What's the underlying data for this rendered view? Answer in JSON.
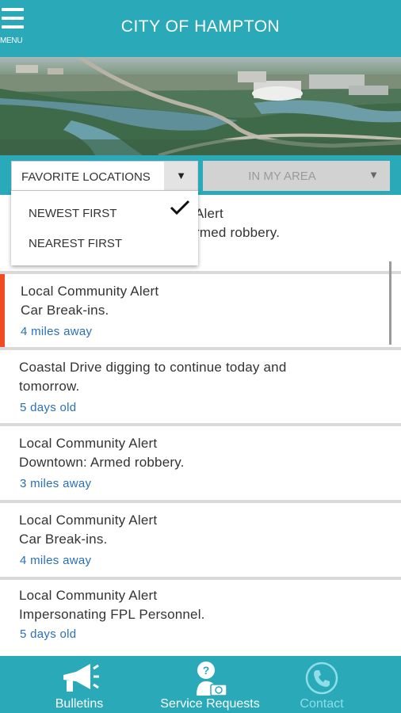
{
  "app": {
    "title": "CITY OF HAMPTON",
    "menu_label": "MENU"
  },
  "filters": {
    "primary": {
      "selected": "FAVORITE LOCATIONS"
    },
    "secondary": {
      "selected": "IN MY AREA"
    },
    "sort_options": [
      {
        "label": "NEWEST FIRST",
        "checked": true
      },
      {
        "label": "NEAREST FIRST",
        "checked": false
      }
    ]
  },
  "alerts": [
    {
      "title": "Local Community Alert",
      "detail": "Downtown: Armed robbery.",
      "meta": "",
      "visible_partial": [
        "Alert",
        "rmed robbery."
      ]
    },
    {
      "title": "Local Community Alert",
      "detail": "Car Break-ins.",
      "meta": "4 miles away",
      "highlight_color": "#f04b22"
    },
    {
      "title": "Coastal Drive digging to continue today and",
      "detail": "tomorrow.",
      "meta": "5 days old"
    },
    {
      "title": "Local Community Alert",
      "detail": "Downtown: Armed robbery.",
      "meta": "3 miles away"
    },
    {
      "title": "Local Community Alert",
      "detail": "Car Break-ins.",
      "meta": "4 miles away"
    },
    {
      "title": "Local Community Alert",
      "detail": "Impersonating FPL Personnel.",
      "meta": "5 days old"
    }
  ],
  "tabs": [
    {
      "label": "Bulletins",
      "icon": "megaphone-icon",
      "active": false
    },
    {
      "label": "Service Requests",
      "icon": "service-request-icon",
      "active": false
    },
    {
      "label": "Contact",
      "icon": "phone-icon",
      "active": true
    }
  ],
  "colors": {
    "brand": "#2aa9b9",
    "link": "#2a6fb8",
    "accent": "#f04b22"
  }
}
